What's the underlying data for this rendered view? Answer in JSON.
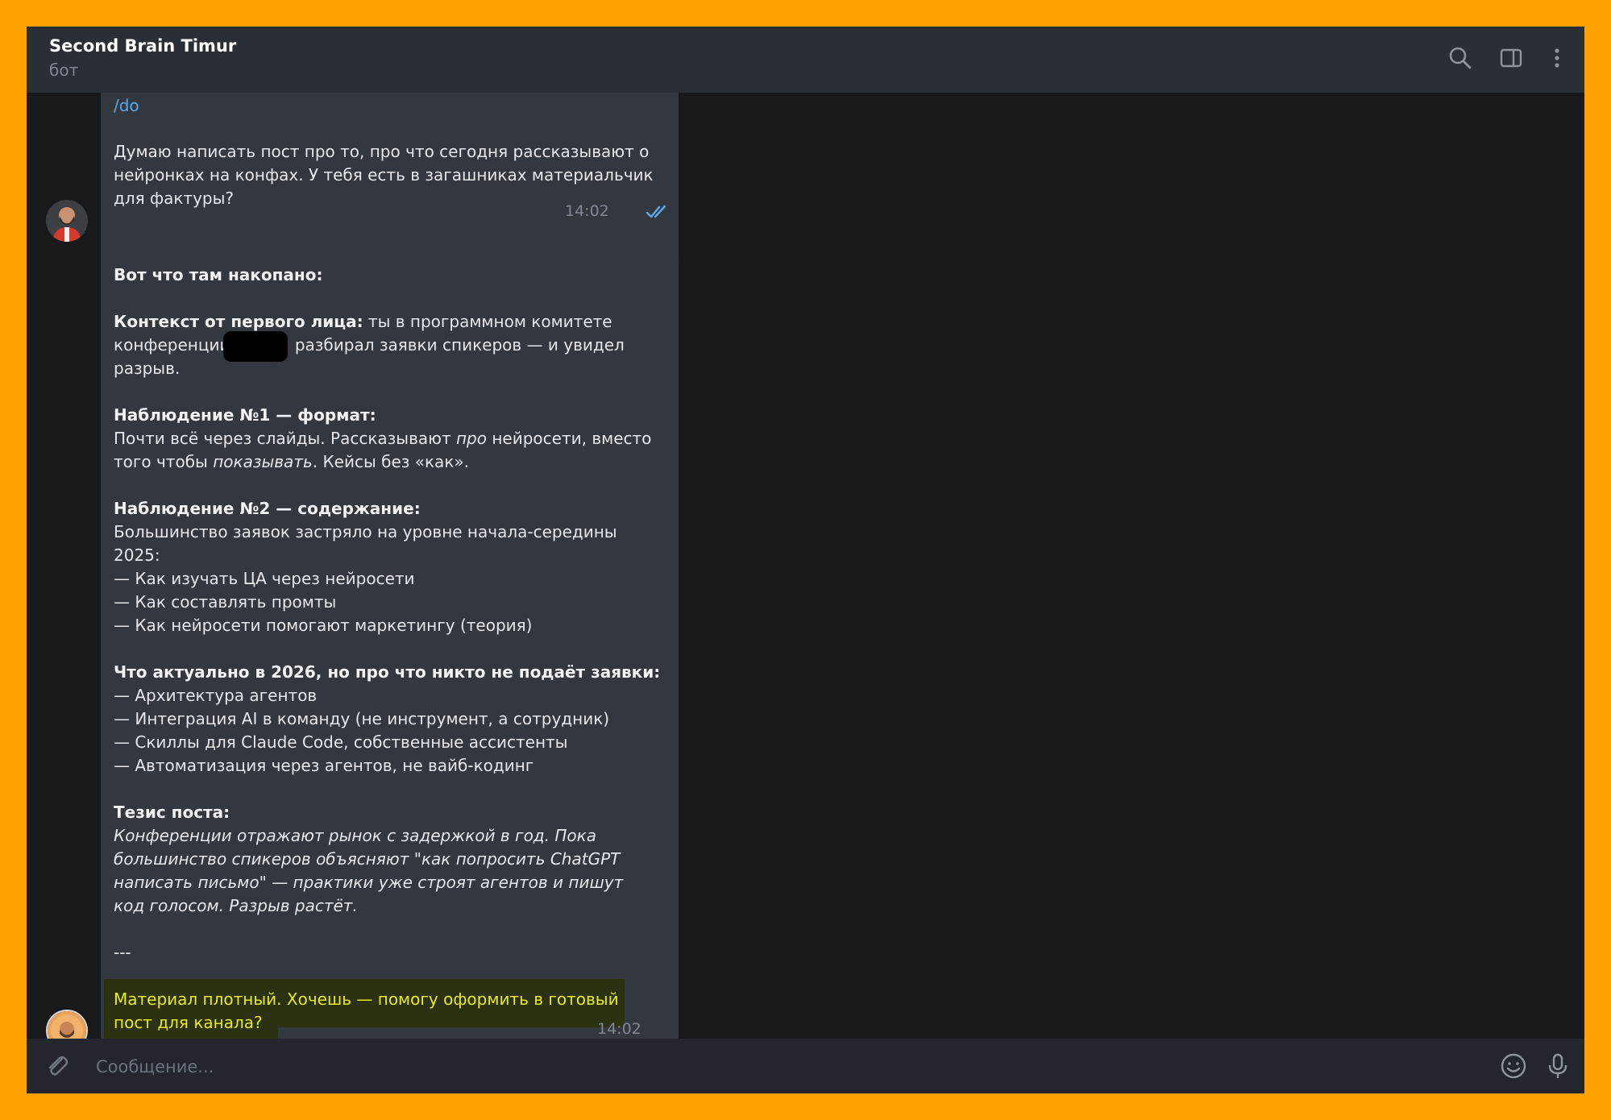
{
  "header": {
    "title": "Second Brain Timur",
    "subtitle": "бот"
  },
  "messages": {
    "outgoing": {
      "command": "/do",
      "lines": [
        "Думаю написать пост про то, про что сегодня рассказывают о",
        "нейронках на конфах. У тебя есть в загашниках материальчик",
        "для фактуры?"
      ],
      "time": "14:02"
    },
    "incoming": {
      "intro": "Вот что там накопано:",
      "context_label": "Контекст от первого лица:",
      "context_line1": " ты в программном комитете",
      "context_line2a": "конференции",
      "context_line2b": " разбирал заявки спикеров — и увидел",
      "context_line3": "разрыв.",
      "obs1_title": "Наблюдение №1 — формат:",
      "obs1_line1a": "Почти всё через слайды. Рассказывают ",
      "obs1_line1b": "про",
      "obs1_line1c": " нейросети, вместо",
      "obs1_line2a": "того чтобы ",
      "obs1_line2b": "показывать",
      "obs1_line2c": ". Кейсы без «как».",
      "obs2_title": "Наблюдение №2 — содержание:",
      "obs2_lines": [
        "Большинство заявок застряло на уровне начала-середины",
        "2025:",
        "— Как изучать ЦА через нейросети",
        "— Как составлять промты",
        "— Как нейросети помогают маркетингу (теория)"
      ],
      "actual_title": "Что актуально в 2026, но про что никто не подаёт заявки:",
      "actual_lines": [
        "— Архитектура агентов",
        "— Интеграция AI в команду (не инструмент, а сотрудник)",
        "— Скиллы для Claude Code, собственные ассистенты",
        "— Автоматизация через агентов, не вайб-кодинг"
      ],
      "thesis_title": "Тезис поста:",
      "thesis_lines": [
        "Конференции отражают рынок с задержкой в год. Пока",
        "большинство спикеров объясняют \"как попросить ChatGPT",
        "написать письмо\" — практики уже строят агентов и пишут",
        "код голосом. Разрыв растёт."
      ],
      "separator": "---",
      "closing_lines": [
        "Материал плотный. Хочешь — помогу оформить в готовый",
        "пост для канала?"
      ],
      "time": "14:02"
    }
  },
  "input": {
    "placeholder": "Сообщение..."
  },
  "colors": {
    "frame": "#FFA200",
    "background": "#17191d",
    "bubble": "#33373e",
    "link": "#5aa9ee",
    "highlight_text": "#e7ec1c"
  },
  "icons": [
    "search-icon",
    "sidebar-toggle-icon",
    "more-vertical-icon",
    "attach-icon",
    "emoji-icon",
    "microphone-icon",
    "double-check-icon"
  ]
}
